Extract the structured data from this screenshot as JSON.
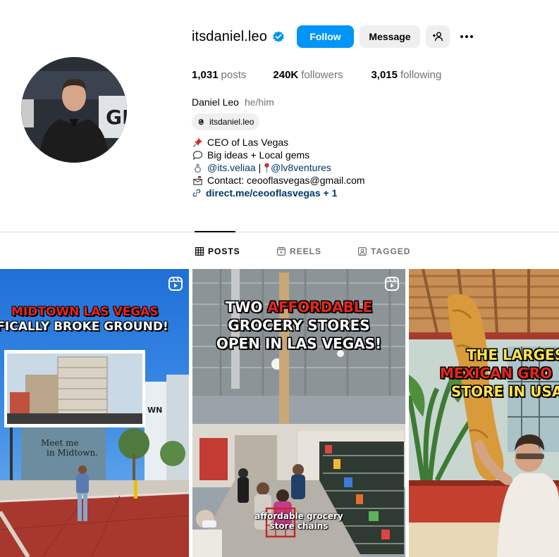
{
  "profile": {
    "username": "itsdaniel.leo",
    "verified": true,
    "buttons": {
      "follow": "Follow",
      "message": "Message"
    },
    "stats": [
      {
        "value": "1,031",
        "label": "posts"
      },
      {
        "value": "240K",
        "label": "followers"
      },
      {
        "value": "3,015",
        "label": "following"
      }
    ],
    "full_name": "Daniel Leo",
    "pronouns": "he/him",
    "threads_handle": "itsdaniel.leo",
    "bio": {
      "line1": "CEO of Las Vegas",
      "line2": "Big ideas + Local gems",
      "mention1": "@its.veliaa",
      "separator": " | ",
      "mention2": "@lv8ventures",
      "contact": "Contact: ceooflasvegas@gmail.com",
      "link": "direct.me/ceooflasvegas + 1"
    },
    "icons": [
      "verified-icon",
      "add-user-icon",
      "more-icon",
      "threads-icon",
      "pin-icon",
      "speech-bubble-icon",
      "ring-icon",
      "pin-red-icon",
      "mailbox-icon",
      "link-icon"
    ]
  },
  "tabs": [
    {
      "label": "POSTS",
      "active": true,
      "icon": "grid-icon"
    },
    {
      "label": "REELS",
      "active": false,
      "icon": "reels-icon"
    },
    {
      "label": "TAGGED",
      "active": false,
      "icon": "tagged-icon"
    }
  ],
  "posts": [
    {
      "title_line1": "MIDTOWN LAS VEGAS",
      "title_line2": "FICALLY BROKE GROUND!",
      "sign_text_1": "Meet me",
      "sign_text_2": "in Midtown.",
      "building_letters": "WN",
      "reel": true,
      "colors": {
        "title1": "#e8251c",
        "title2": "#ffffff"
      }
    },
    {
      "title_line1a": "TWO ",
      "title_line1b": "AFFORDABLE",
      "title_line2": "GROCERY STORES",
      "title_line3": "OPEN IN LAS VEGAS!",
      "caption_1": "affordable grocery",
      "caption_2": "store chains",
      "reel": true,
      "colors": {
        "accent": "#e8251c"
      }
    },
    {
      "title_line1": "THE LARGES",
      "title_line2": "MEXICAN GRO",
      "title_line3": "STORE IN USA",
      "reel": false,
      "colors": {
        "line1": "#ffe34d",
        "line2": "#e8251c",
        "line3": "#ffe34d"
      }
    }
  ]
}
